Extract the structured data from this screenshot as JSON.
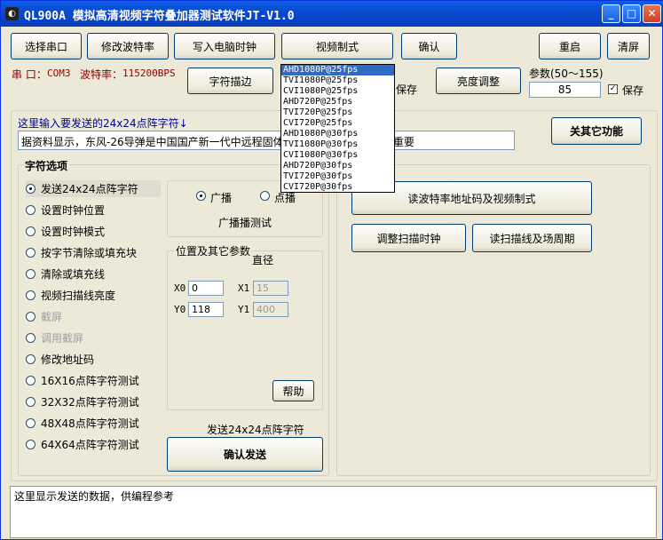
{
  "titlebar": {
    "title": "QL900A 模拟高清视频字符叠加器测试软件JT-V1.0",
    "icon": "app-icon",
    "minimize": "_",
    "maximize": "□",
    "close": "✕"
  },
  "toolbar": {
    "select_port": "选择串口",
    "change_baud": "修改波特率",
    "write_clock": "写入电脑时钟",
    "video_format": "视频制式",
    "confirm": "确认",
    "restart": "重启",
    "clear": "清屏"
  },
  "status": {
    "port_label": "串 口：",
    "port_value": "COM3",
    "baud_label": "波特率：",
    "baud_value": "115200BPS"
  },
  "row2": {
    "char_outline": "字符描边",
    "save_left": "保存",
    "brightness": "亮度调整",
    "param_label": "参数(50～155)",
    "param_value": "85",
    "save_right": "保存",
    "save_checked": "✓"
  },
  "send_area": {
    "hint": "这里输入要发送的24x24点阵字符↓",
    "text": "据资料显示，东风-26导弹是中国国产新一代中远程固体... 常兼备，具备对陆上重要",
    "close_other": "关其它功能"
  },
  "options": {
    "title": "字符选项",
    "items": [
      {
        "label": "发送24x24点阵字符",
        "selected": true,
        "disabled": false
      },
      {
        "label": "设置时钟位置",
        "selected": false,
        "disabled": false
      },
      {
        "label": "设置时钟模式",
        "selected": false,
        "disabled": false
      },
      {
        "label": "按字节清除或填充块",
        "selected": false,
        "disabled": false
      },
      {
        "label": "清除或填充线",
        "selected": false,
        "disabled": false
      },
      {
        "label": "视频扫描线亮度",
        "selected": false,
        "disabled": false
      },
      {
        "label": "截屏",
        "selected": false,
        "disabled": true
      },
      {
        "label": "调用截屏",
        "selected": false,
        "disabled": true
      },
      {
        "label": "修改地址码",
        "selected": false,
        "disabled": false
      },
      {
        "label": "16X16点阵字符测试",
        "selected": false,
        "disabled": false
      },
      {
        "label": "32X32点阵字符测试",
        "selected": false,
        "disabled": false
      },
      {
        "label": "48X48点阵字符测试",
        "selected": false,
        "disabled": false
      },
      {
        "label": "64X64点阵字符测试",
        "selected": false,
        "disabled": false
      }
    ]
  },
  "broadcast": {
    "broadcast": "广播",
    "point": "点播",
    "test": "广播播测试"
  },
  "position": {
    "title": "位置及其它参数",
    "diameter": "直径",
    "x0_label": "X0",
    "x0": "0",
    "y0_label": "Y0",
    "y0": "118",
    "x1_label": "X1",
    "x1": "15",
    "y1_label": "Y1",
    "y1": "400",
    "help": "帮助"
  },
  "send": {
    "caption": "发送24x24点阵字符",
    "button": "确认发送"
  },
  "right": {
    "read_baud": "读波特率地址码及视频制式",
    "adjust_clock": "调整扫描时钟",
    "read_scan": "读扫描线及场周期"
  },
  "dropdown": {
    "items": [
      "AHD1080P@25fps",
      "TVI1080P@25fps",
      "CVI1080P@25fps",
      "AHD720P@25fps",
      "TVI720P@25fps",
      "CVI720P@25fps",
      "AHD1080P@30fps",
      "TVI1080P@30fps",
      "CVI1080P@30fps",
      "AHD720P@30fps",
      "TVI720P@30fps",
      "CVI720P@30fps"
    ],
    "highlighted": 0
  },
  "output": {
    "text": "这里显示发送的数据，供编程参考"
  }
}
